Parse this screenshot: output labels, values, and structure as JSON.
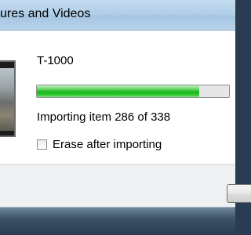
{
  "window": {
    "title": "ures and Videos"
  },
  "import": {
    "device_name": "T-1000",
    "progress": {
      "current": 286,
      "total": 338,
      "fraction": 0.846
    },
    "status_text": "Importing item 286 of 338",
    "erase_checkbox": {
      "label": "Erase after importing",
      "checked": false
    }
  },
  "colors": {
    "progress_green": "#1db41f",
    "titlebar": "#b2cfe9",
    "footer": "#eef0f2"
  }
}
